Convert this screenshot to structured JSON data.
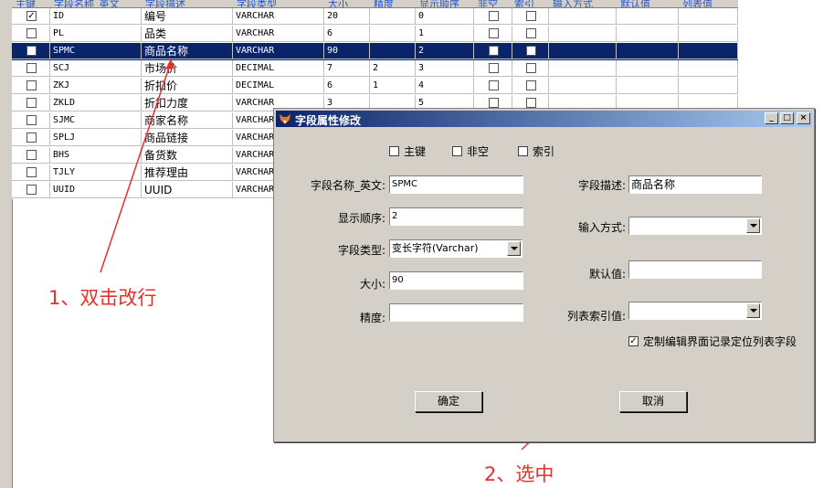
{
  "grid": {
    "headers": [
      "主键",
      "字段名称_英文",
      "字段描述",
      "字段类型",
      "大小",
      "精度",
      "显示顺序",
      "非空",
      "索引",
      "输入方式",
      "默认值",
      "列表值"
    ],
    "rows": [
      {
        "pk": true,
        "en": "ID",
        "desc": "编号",
        "type": "VARCHAR",
        "size": "20",
        "prec": "",
        "order": "0",
        "notnull": false,
        "index": false
      },
      {
        "pk": false,
        "en": "PL",
        "desc": "品类",
        "type": "VARCHAR",
        "size": "6",
        "prec": "",
        "order": "1",
        "notnull": false,
        "index": false
      },
      {
        "pk": false,
        "en": "SPMC",
        "desc": "商品名称",
        "type": "VARCHAR",
        "size": "90",
        "prec": "",
        "order": "2",
        "notnull": false,
        "index": false,
        "selected": true
      },
      {
        "pk": false,
        "en": "SCJ",
        "desc": "市场价",
        "type": "DECIMAL",
        "size": "7",
        "prec": "2",
        "order": "3",
        "notnull": false,
        "index": false
      },
      {
        "pk": false,
        "en": "ZKJ",
        "desc": "折扣价",
        "type": "DECIMAL",
        "size": "6",
        "prec": "1",
        "order": "4",
        "notnull": false,
        "index": false
      },
      {
        "pk": false,
        "en": "ZKLD",
        "desc": "折扣力度",
        "type": "VARCHAR",
        "size": "3",
        "prec": "",
        "order": "5",
        "notnull": false,
        "index": false
      },
      {
        "pk": false,
        "en": "SJMC",
        "desc": "商家名称",
        "type": "VARCHAR",
        "size": "",
        "prec": "",
        "order": "",
        "notnull": false,
        "index": false
      },
      {
        "pk": false,
        "en": "SPLJ",
        "desc": "商品链接",
        "type": "VARCHAR",
        "size": "",
        "prec": "",
        "order": "",
        "notnull": false,
        "index": false
      },
      {
        "pk": false,
        "en": "BHS",
        "desc": "备货数",
        "type": "VARCHAR",
        "size": "",
        "prec": "",
        "order": "",
        "notnull": false,
        "index": false
      },
      {
        "pk": false,
        "en": "TJLY",
        "desc": "推荐理由",
        "type": "VARCHAR",
        "size": "",
        "prec": "",
        "order": "",
        "notnull": false,
        "index": false
      },
      {
        "pk": false,
        "en": "UUID",
        "desc": "UUID",
        "type": "VARCHAR",
        "size": "",
        "prec": "",
        "order": "",
        "notnull": false,
        "index": false
      }
    ]
  },
  "annotations": {
    "step1": "1、双击改行",
    "step2": "2、选中"
  },
  "dialog": {
    "title": "字段属性修改",
    "title_icon": "fox-app-icon",
    "minimize": "_",
    "maximize": "□",
    "close": "×",
    "cb_primary_key": "主键",
    "cb_not_null": "非空",
    "cb_index": "索引",
    "label_name_en": "字段名称_英文:",
    "value_name_en": "SPMC",
    "label_desc": "字段描述:",
    "value_desc": "商品名称",
    "label_order": "显示顺序:",
    "value_order": "2",
    "label_input_mode": "输入方式:",
    "value_input_mode": "",
    "label_type": "字段类型:",
    "value_type": "变长字符(Varchar)",
    "label_size": "大小:",
    "value_size": "90",
    "label_default": "默认值:",
    "value_default": "",
    "label_precision": "精度:",
    "value_precision": "",
    "label_list_index": "列表索引值:",
    "value_list_index": "",
    "cb_locate_label": "定制编辑界面记录定位列表字段",
    "cb_locate_checked": true,
    "ok_label": "确定",
    "cancel_label": "取消"
  }
}
